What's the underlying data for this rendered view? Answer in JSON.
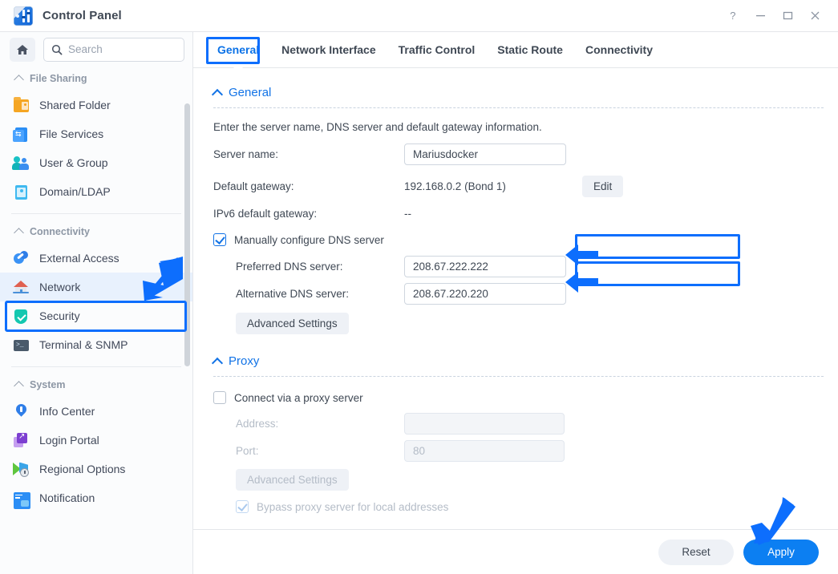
{
  "window": {
    "title": "Control Panel",
    "app_icon": "control-panel-icon",
    "controls": {
      "help": "?",
      "minimize": "minimize-icon",
      "maximize": "maximize-icon",
      "close": "close-icon"
    }
  },
  "sidebar": {
    "home_icon": "home-icon",
    "search": {
      "placeholder": "Search",
      "value": "",
      "icon": "search-icon"
    },
    "groups": [
      {
        "label": "File Sharing",
        "items": [
          {
            "label": "Shared Folder",
            "icon": "shared-folder-icon",
            "selected": false
          },
          {
            "label": "File Services",
            "icon": "file-services-icon",
            "selected": false
          },
          {
            "label": "User & Group",
            "icon": "user-group-icon",
            "selected": false
          },
          {
            "label": "Domain/LDAP",
            "icon": "domain-ldap-icon",
            "selected": false
          }
        ]
      },
      {
        "label": "Connectivity",
        "items": [
          {
            "label": "External Access",
            "icon": "external-access-icon",
            "selected": false
          },
          {
            "label": "Network",
            "icon": "network-icon",
            "selected": true
          },
          {
            "label": "Security",
            "icon": "security-icon",
            "selected": false
          },
          {
            "label": "Terminal & SNMP",
            "icon": "terminal-snmp-icon",
            "selected": false
          }
        ]
      },
      {
        "label": "System",
        "items": [
          {
            "label": "Info Center",
            "icon": "info-center-icon",
            "selected": false
          },
          {
            "label": "Login Portal",
            "icon": "login-portal-icon",
            "selected": false
          },
          {
            "label": "Regional Options",
            "icon": "regional-options-icon",
            "selected": false
          },
          {
            "label": "Notification",
            "icon": "notification-icon",
            "selected": false
          }
        ]
      }
    ]
  },
  "tabs": [
    {
      "label": "General",
      "active": true
    },
    {
      "label": "Network Interface",
      "active": false
    },
    {
      "label": "Traffic Control",
      "active": false
    },
    {
      "label": "Static Route",
      "active": false
    },
    {
      "label": "Connectivity",
      "active": false
    }
  ],
  "general": {
    "section_title": "General",
    "hint": "Enter the server name, DNS server and default gateway information.",
    "server_name_label": "Server name:",
    "server_name_value": "Mariusdocker",
    "default_gateway_label": "Default gateway:",
    "default_gateway_value": "192.168.0.2 (Bond 1)",
    "edit_button": "Edit",
    "ipv6_gateway_label": "IPv6 default gateway:",
    "ipv6_gateway_value": "--",
    "manual_dns_label": "Manually configure DNS server",
    "manual_dns_checked": true,
    "preferred_dns_label": "Preferred DNS server:",
    "preferred_dns_value": "208.67.222.222",
    "alternative_dns_label": "Alternative DNS server:",
    "alternative_dns_value": "208.67.220.220",
    "advanced_settings_button": "Advanced Settings"
  },
  "proxy": {
    "section_title": "Proxy",
    "connect_label": "Connect via a proxy server",
    "connect_checked": false,
    "address_label": "Address:",
    "address_value": "",
    "port_label": "Port:",
    "port_placeholder": "80",
    "advanced_settings_button": "Advanced Settings",
    "bypass_label": "Bypass proxy server for local addresses",
    "bypass_checked": true
  },
  "footer": {
    "reset_label": "Reset",
    "apply_label": "Apply"
  },
  "annotations": {
    "accent_color": "#0d6efd",
    "arrows": [
      {
        "name": "arrow-to-network-item",
        "direction": "down-left"
      },
      {
        "name": "arrow-to-preferred-dns",
        "direction": "left"
      },
      {
        "name": "arrow-to-alternative-dns",
        "direction": "left"
      },
      {
        "name": "arrow-to-apply-button",
        "direction": "down-left"
      }
    ],
    "highlight_boxes": [
      {
        "name": "highlight-general-tab"
      },
      {
        "name": "highlight-network-sidebar-item"
      },
      {
        "name": "highlight-preferred-dns-input"
      },
      {
        "name": "highlight-alternative-dns-input"
      }
    ]
  }
}
